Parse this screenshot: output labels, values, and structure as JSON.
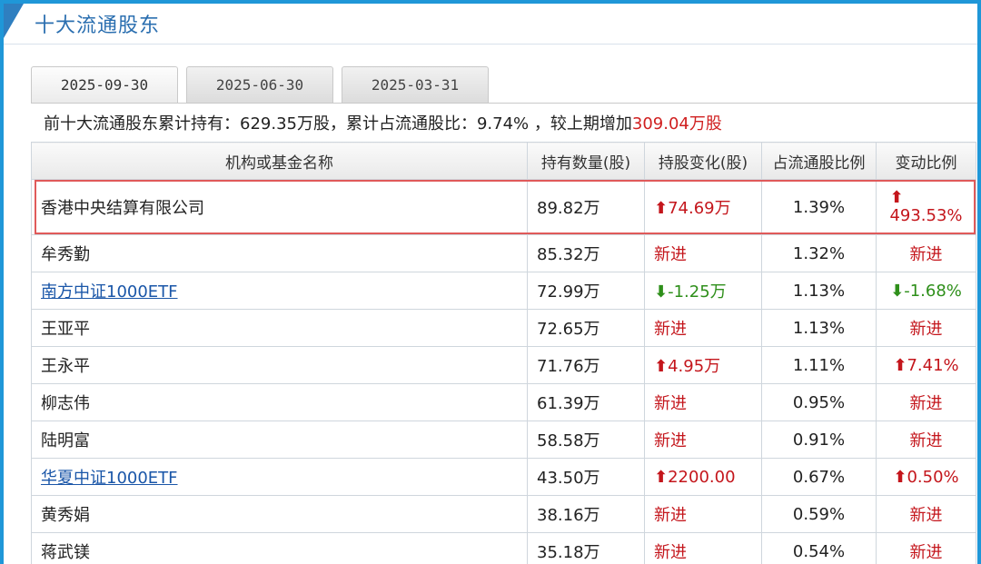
{
  "title": "十大流通股东",
  "tabs": [
    {
      "label": "2025-09-30",
      "active": true
    },
    {
      "label": "2025-06-30",
      "active": false
    },
    {
      "label": "2025-03-31",
      "active": false
    }
  ],
  "summary": {
    "prefix": "前十大流通股东累计持有：629.35万股，累计占流通股比：9.74% ，较上期增加",
    "increase": "309.04万股"
  },
  "columns": [
    "机构或基金名称",
    "持有数量(股)",
    "持股变化(股)",
    "占流通股比例",
    "变动比例"
  ],
  "rows": [
    {
      "name": "香港中央结算有限公司",
      "link": false,
      "amount": "89.82万",
      "change": "74.69万",
      "change_dir": "up",
      "ratio": "1.39%",
      "pct": "493.53%",
      "pct_dir": "up"
    },
    {
      "name": "牟秀勤",
      "link": false,
      "amount": "85.32万",
      "change": "新进",
      "change_dir": "new",
      "ratio": "1.32%",
      "pct": "新进",
      "pct_dir": "new"
    },
    {
      "name": "南方中证1000ETF",
      "link": true,
      "amount": "72.99万",
      "change": "-1.25万",
      "change_dir": "down",
      "ratio": "1.13%",
      "pct": "-1.68%",
      "pct_dir": "down"
    },
    {
      "name": "王亚平",
      "link": false,
      "amount": "72.65万",
      "change": "新进",
      "change_dir": "new",
      "ratio": "1.13%",
      "pct": "新进",
      "pct_dir": "new"
    },
    {
      "name": "王永平",
      "link": false,
      "amount": "71.76万",
      "change": "4.95万",
      "change_dir": "up",
      "ratio": "1.11%",
      "pct": "7.41%",
      "pct_dir": "up"
    },
    {
      "name": "柳志伟",
      "link": false,
      "amount": "61.39万",
      "change": "新进",
      "change_dir": "new",
      "ratio": "0.95%",
      "pct": "新进",
      "pct_dir": "new"
    },
    {
      "name": "陆明富",
      "link": false,
      "amount": "58.58万",
      "change": "新进",
      "change_dir": "new",
      "ratio": "0.91%",
      "pct": "新进",
      "pct_dir": "new"
    },
    {
      "name": "华夏中证1000ETF",
      "link": true,
      "amount": "43.50万",
      "change": "2200.00",
      "change_dir": "up",
      "ratio": "0.67%",
      "pct": "0.50%",
      "pct_dir": "up"
    },
    {
      "name": "黄秀娟",
      "link": false,
      "amount": "38.16万",
      "change": "新进",
      "change_dir": "new",
      "ratio": "0.59%",
      "pct": "新进",
      "pct_dir": "new"
    },
    {
      "name": "蒋武镁",
      "link": false,
      "amount": "35.18万",
      "change": "新进",
      "change_dir": "new",
      "ratio": "0.54%",
      "pct": "新进",
      "pct_dir": "new"
    }
  ],
  "colors": {
    "up": "#c4161c",
    "down": "#2e8f1a",
    "link": "#1a56a8",
    "frame": "#1f97d8",
    "highlight": "#e05a5a"
  }
}
